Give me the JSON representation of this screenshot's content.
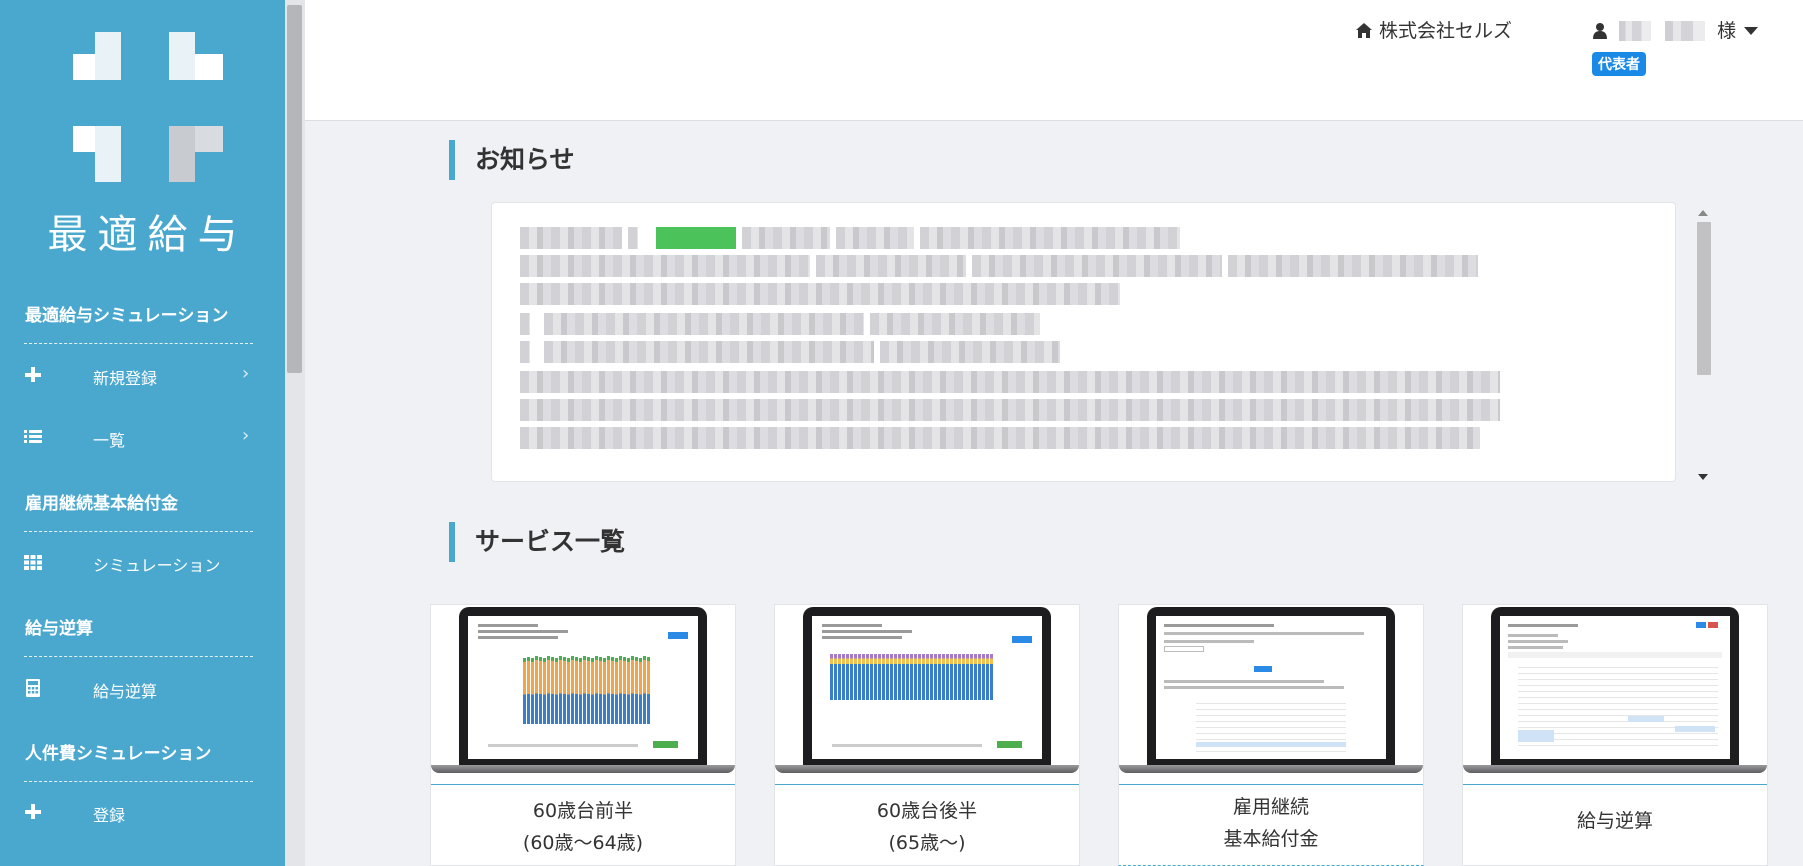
{
  "sidebar": {
    "logo_text": "最適給与",
    "sections": [
      {
        "title": "最適給与シミュレーション"
      },
      {
        "title": "雇用継続基本給付金"
      },
      {
        "title": "給与逆算"
      },
      {
        "title": "人件費シミュレーション"
      }
    ],
    "items": [
      {
        "label": "新規登録",
        "icon": "plus-icon",
        "chevron": "›"
      },
      {
        "label": "一覧",
        "icon": "list-icon",
        "chevron": "›"
      },
      {
        "label": "シミュレーション",
        "icon": "grid-icon"
      },
      {
        "label": "給与逆算",
        "icon": "calculator-icon"
      },
      {
        "label": "登録",
        "icon": "plus-icon"
      }
    ]
  },
  "header": {
    "company_name": "株式会社セルズ",
    "company_icon": "home-icon",
    "user_suffix": "様",
    "user_icon": "user-icon",
    "role_badge": "代表者"
  },
  "notice": {
    "heading": "お知らせ"
  },
  "services": {
    "heading": "サービス一覧",
    "cards": [
      {
        "title_line1": "60歳台前半",
        "title_line2": "(60歳〜64歳)"
      },
      {
        "title_line1": "60歳台後半",
        "title_line2": "(65歳〜)"
      },
      {
        "title_line1": "雇用継続",
        "title_line2": "基本給付金"
      },
      {
        "title_line1": "給与逆算",
        "title_line2": ""
      }
    ]
  },
  "colors": {
    "sidebar": "#4aa8cf",
    "accent": "#4aa8cf",
    "badge": "#1a8ae6",
    "notice_tag": "#4cc35a"
  }
}
